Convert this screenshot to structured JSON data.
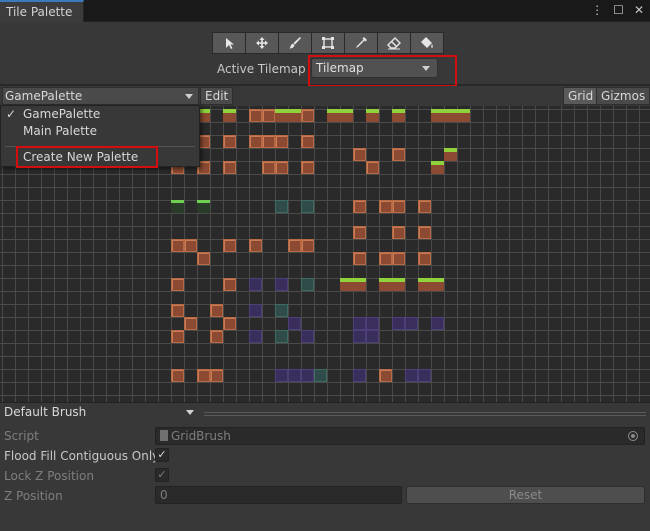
{
  "window": {
    "tab_title": "Tile Palette",
    "menu_icon": "kebab-menu-icon",
    "maximize_icon": "maximize-icon",
    "close_icon": "close-icon"
  },
  "toolbar": {
    "tools": [
      {
        "icon": "select-arrow-icon"
      },
      {
        "icon": "move-icon"
      },
      {
        "icon": "paint-brush-icon"
      },
      {
        "icon": "box-fill-icon"
      },
      {
        "icon": "picker-icon"
      },
      {
        "icon": "eraser-icon"
      },
      {
        "icon": "fill-bucket-icon"
      }
    ],
    "active_tilemap_label": "Active Tilemap",
    "active_tilemap_value": "Tilemap"
  },
  "palette_bar": {
    "selected_palette": "GamePalette",
    "edit_label": "Edit",
    "grid_label": "Grid",
    "gizmos_label": "Gizmos"
  },
  "palette_menu": {
    "items": [
      {
        "label": "GamePalette",
        "checked": true
      },
      {
        "label": "Main Palette",
        "checked": false
      }
    ],
    "create_label": "Create New Palette",
    "check_glyph": "✓"
  },
  "brush": {
    "selected_brush": "Default Brush",
    "script_label": "Script",
    "script_value": "GridBrush",
    "flood_fill_label": "Flood Fill Contiguous Only",
    "flood_fill_checked": "✓",
    "lock_z_label": "Lock Z Position",
    "lock_z_checked": "✓",
    "z_position_label": "Z Position",
    "z_position_value": "0",
    "reset_label": "Reset"
  },
  "colors": {
    "highlight_red": "#d40e0e",
    "accent_blue": "#3a79bb",
    "grass_green": "#8fd23c",
    "dirt_brown": "#8c4a32",
    "dungeon_purple": "#3a2e5c"
  }
}
